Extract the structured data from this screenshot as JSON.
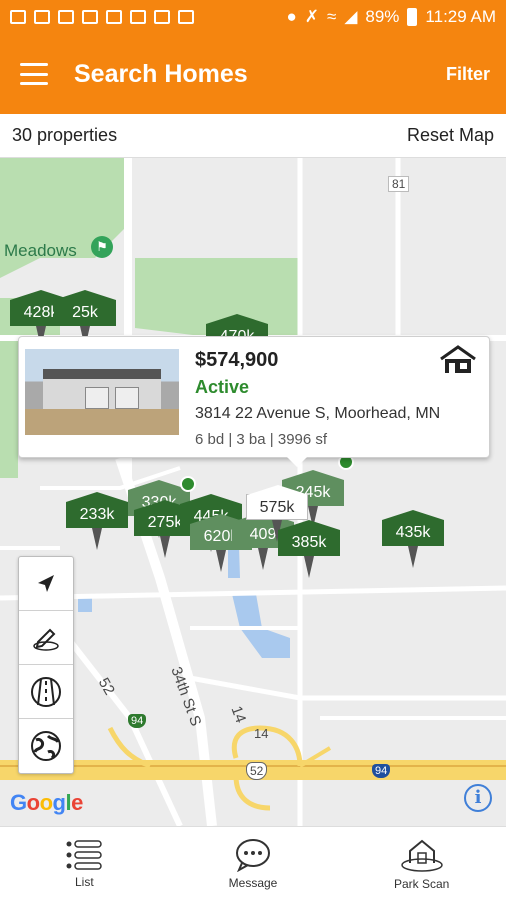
{
  "status_bar": {
    "battery": "89%",
    "time": "11:29 AM"
  },
  "app_bar": {
    "title": "Search Homes",
    "filter_label": "Filter"
  },
  "sub_bar": {
    "count": "30 properties",
    "reset_label": "Reset Map"
  },
  "map": {
    "labels": {
      "meadows": "Meadows",
      "road_81": "81",
      "road_52": "52",
      "street_34th": "34th St S",
      "road_14a": "14",
      "road_14b": "14",
      "shield_94a": "94",
      "shield_52": "52",
      "shield_94b": "94",
      "google": "Google"
    },
    "pins": [
      "428k",
      "25k",
      "470k",
      "233k",
      "330k",
      "275k",
      "445k",
      "620k",
      "409",
      "575k",
      "245k",
      "385k",
      "435k"
    ]
  },
  "popup": {
    "price": "$574,900",
    "status": "Active",
    "address": "3814 22 Avenue S, Moorhead, MN",
    "specs": "6 bd | 3 ba | 3996 sf"
  },
  "tools": {
    "icons": [
      "navigation-arrow-icon",
      "draw-pencil-icon",
      "roads-layer-icon",
      "globe-satellite-icon"
    ]
  },
  "bottom_nav": {
    "list": "List",
    "message": "Message",
    "park_scan": "Park Scan"
  },
  "colors": {
    "brand_orange": "#f5850f",
    "pin_green": "#2e6b2e",
    "status_green": "#2e8b2e",
    "park_green": "#b9deb0",
    "road_yellow": "#f7d66a",
    "water_blue": "#a9c9ee"
  }
}
